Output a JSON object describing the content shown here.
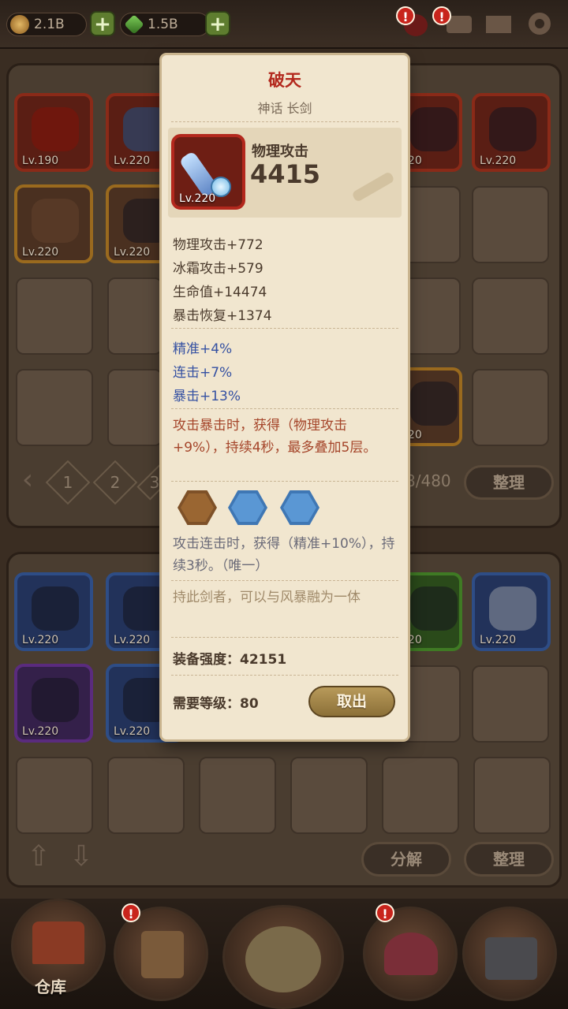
{
  "topbar": {
    "gold": "2.1B",
    "gems": "1.5B"
  },
  "inventory": {
    "items_top": [
      {
        "lv": "Lv.190",
        "rarity": "red"
      },
      {
        "lv": "Lv.220",
        "rarity": "red"
      },
      {
        "lv": "220",
        "rarity": "red"
      },
      {
        "lv": "Lv.220",
        "rarity": "red"
      },
      {
        "lv": "Lv.220",
        "rarity": "gold"
      },
      {
        "lv": "Lv.220",
        "rarity": "gold"
      },
      {
        "lv": "220",
        "rarity": "gold"
      }
    ],
    "pages": [
      "1",
      "2",
      "3"
    ],
    "capacity": "8/480",
    "sort_label": "整理"
  },
  "backpack": {
    "items": [
      {
        "lv": "Lv.220",
        "rarity": "blue"
      },
      {
        "lv": "Lv.220",
        "rarity": "blue"
      },
      {
        "lv": "220",
        "rarity": "green"
      },
      {
        "lv": "Lv.220",
        "rarity": "blue"
      },
      {
        "lv": "Lv.220",
        "rarity": "purple"
      },
      {
        "lv": "Lv.220",
        "rarity": "blue"
      }
    ],
    "decompose_label": "分解",
    "sort_label": "整理"
  },
  "nav": {
    "warehouse_label": "仓库"
  },
  "popup": {
    "name": "破天",
    "type": "神话 长剑",
    "icon_level": "Lv.220",
    "main_stat_label": "物理攻击",
    "main_stat_value": "4415",
    "base_stats": [
      "物理攻击+772",
      "冰霜攻击+579",
      "生命值+14474",
      "暴击恢复+1374"
    ],
    "bonus_stats": [
      "精准+4%",
      "连击+7%",
      "暴击+13%"
    ],
    "passive": "攻击暴击时，获得（物理攻击+9%），持续4秒，最多叠加5层。",
    "set_effect": "攻击连击时，获得（精准+10%），持续3秒。（唯一）",
    "lore": "持此剑者，可以与风暴融为一体",
    "strength_label": "装备强度：",
    "strength_value": "42151",
    "required_level_label": "需要等级：",
    "required_level_value": "80",
    "take_out_label": "取出",
    "colors": {
      "title": "#b3281d",
      "bonus": "#3551a2",
      "passive": "#a5452a"
    }
  }
}
